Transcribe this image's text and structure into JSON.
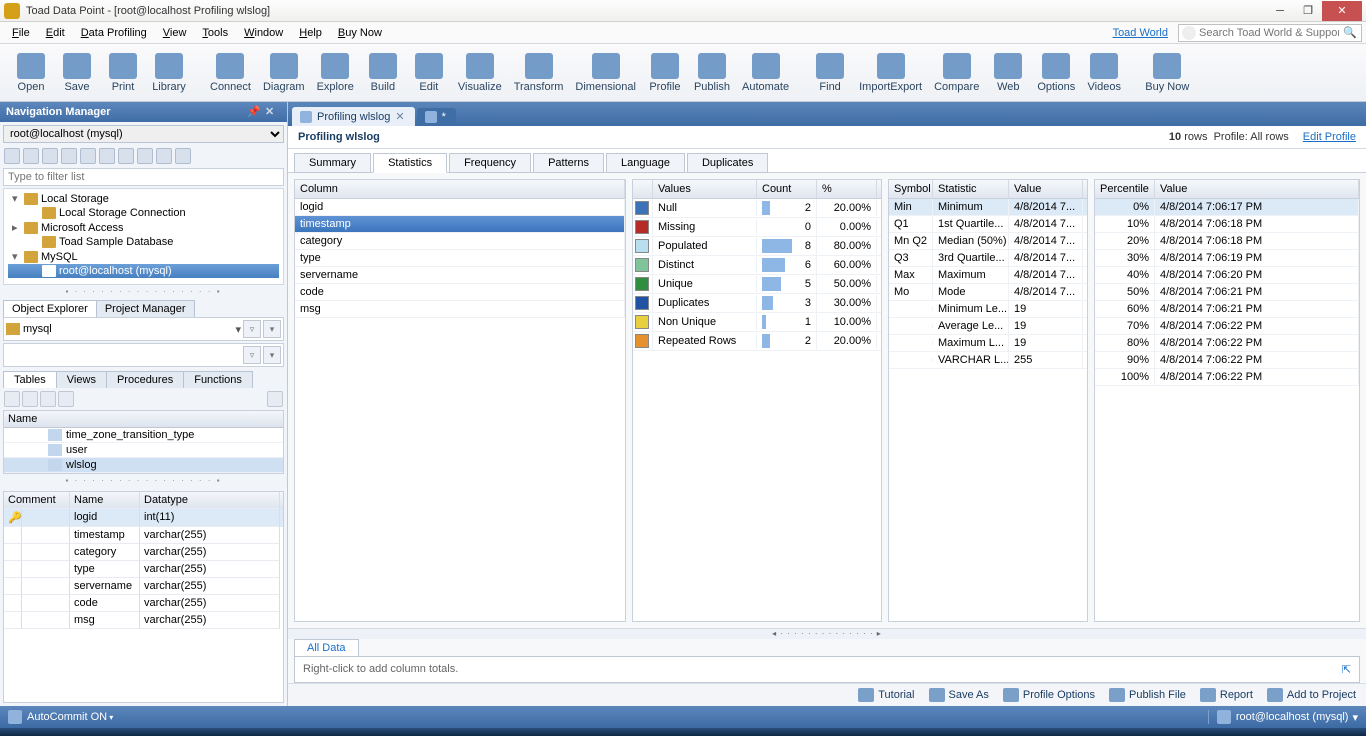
{
  "window": {
    "title": "Toad Data Point - [root@localhost Profiling wlslog]"
  },
  "menu": [
    "File",
    "Edit",
    "Data Profiling",
    "View",
    "Tools",
    "Window",
    "Help",
    "Buy Now"
  ],
  "menu_link": "Toad World",
  "search_placeholder": "Search Toad World & Support",
  "toolbar": [
    {
      "label": "Open"
    },
    {
      "label": "Save"
    },
    {
      "label": "Print"
    },
    {
      "label": "Library"
    },
    {
      "sep": true
    },
    {
      "label": "Connect"
    },
    {
      "label": "Diagram"
    },
    {
      "label": "Explore"
    },
    {
      "label": "Build"
    },
    {
      "label": "Edit"
    },
    {
      "label": "Visualize"
    },
    {
      "label": "Transform"
    },
    {
      "label": "Dimensional"
    },
    {
      "label": "Profile"
    },
    {
      "label": "Publish"
    },
    {
      "label": "Automate"
    },
    {
      "sep": true
    },
    {
      "label": "Find"
    },
    {
      "label": "ImportExport"
    },
    {
      "label": "Compare"
    },
    {
      "label": "Web"
    },
    {
      "label": "Options"
    },
    {
      "label": "Videos"
    },
    {
      "sep": true
    },
    {
      "label": "Buy Now"
    }
  ],
  "nav": {
    "title": "Navigation Manager",
    "connection": "root@localhost (mysql)",
    "filter_placeholder": "Type to filter list",
    "tree": [
      {
        "indent": 0,
        "expander": "▾",
        "label": "Local Storage"
      },
      {
        "indent": 1,
        "expander": "",
        "label": "Local Storage Connection"
      },
      {
        "indent": 0,
        "expander": "▸",
        "label": "Microsoft Access"
      },
      {
        "indent": 1,
        "expander": "",
        "label": "Toad Sample Database"
      },
      {
        "indent": 0,
        "expander": "▾",
        "label": "MySQL"
      },
      {
        "indent": 1,
        "expander": "",
        "label": "root@localhost (mysql)",
        "selected": true
      }
    ],
    "subtabs": [
      "Object Explorer",
      "Project Manager"
    ],
    "subtab_active": 0,
    "db_label": "mysql",
    "lower_tabs": [
      "Tables",
      "Views",
      "Procedures",
      "Functions"
    ],
    "lower_active": 0,
    "name_header": "Name",
    "name_rows": [
      {
        "label": "time_zone_transition_type"
      },
      {
        "label": "user"
      },
      {
        "label": "wlslog",
        "selected": true
      }
    ],
    "schema_headers": [
      "Comment",
      "Name",
      "Datatype"
    ],
    "schema_rows": [
      {
        "key": true,
        "selected": true,
        "name": "logid",
        "datatype": "int(11)"
      },
      {
        "name": "timestamp",
        "datatype": "varchar(255)"
      },
      {
        "name": "category",
        "datatype": "varchar(255)"
      },
      {
        "name": "type",
        "datatype": "varchar(255)"
      },
      {
        "name": "servername",
        "datatype": "varchar(255)"
      },
      {
        "name": "code",
        "datatype": "varchar(255)"
      },
      {
        "name": "msg",
        "datatype": "varchar(255)"
      }
    ]
  },
  "doc_tabs": [
    {
      "label": "Profiling wlslog",
      "active": true,
      "closable": true
    },
    {
      "label": "*",
      "icon_only": true
    }
  ],
  "profile": {
    "title": "Profiling wlslog",
    "rows_count": "10",
    "rows_label": "rows",
    "profile_label": "Profile: All rows",
    "edit_link": "Edit Profile"
  },
  "ptabs": [
    "Summary",
    "Statistics",
    "Frequency",
    "Patterns",
    "Language",
    "Duplicates"
  ],
  "ptab_active": 1,
  "columns_grid": {
    "header": "Column",
    "rows": [
      "logid",
      "timestamp",
      "category",
      "type",
      "servername",
      "code",
      "msg"
    ],
    "selected": 1
  },
  "values_grid": {
    "headers": [
      "",
      "Values",
      "Count",
      "%"
    ],
    "rows": [
      {
        "color": "#3c72b7",
        "label": "Null",
        "count": 2,
        "bar": 20,
        "pct": "20.00%"
      },
      {
        "color": "#b52b27",
        "label": "Missing",
        "count": 0,
        "bar": 0,
        "pct": "0.00%"
      },
      {
        "color": "#b8dff0",
        "label": "Populated",
        "count": 8,
        "bar": 80,
        "pct": "80.00%"
      },
      {
        "color": "#7fc49a",
        "label": "Distinct",
        "count": 6,
        "bar": 60,
        "pct": "60.00%"
      },
      {
        "color": "#2f8f3e",
        "label": "Unique",
        "count": 5,
        "bar": 50,
        "pct": "50.00%"
      },
      {
        "color": "#2153a4",
        "label": "Duplicates",
        "count": 3,
        "bar": 30,
        "pct": "30.00%"
      },
      {
        "color": "#e7cf3f",
        "label": "Non Unique",
        "count": 1,
        "bar": 10,
        "pct": "10.00%"
      },
      {
        "color": "#e6902e",
        "label": "Repeated Rows",
        "count": 2,
        "bar": 20,
        "pct": "20.00%"
      }
    ]
  },
  "stats_grid": {
    "headers": [
      "Symbol",
      "Statistic",
      "Value"
    ],
    "rows": [
      {
        "sym": "Min",
        "stat": "Minimum",
        "val": "4/8/2014 7...",
        "sel": true
      },
      {
        "sym": "Q1",
        "stat": "1st Quartile...",
        "val": "4/8/2014 7..."
      },
      {
        "sym": "Mn Q2",
        "stat": "Median (50%)",
        "val": "4/8/2014 7..."
      },
      {
        "sym": "Q3",
        "stat": "3rd Quartile...",
        "val": "4/8/2014 7..."
      },
      {
        "sym": "Max",
        "stat": "Maximum",
        "val": "4/8/2014 7..."
      },
      {
        "sym": "Mo",
        "stat": "Mode",
        "val": "4/8/2014 7..."
      },
      {
        "sym": "",
        "stat": "Minimum Le...",
        "val": "19"
      },
      {
        "sym": "",
        "stat": "Average Le...",
        "val": "19"
      },
      {
        "sym": "",
        "stat": "Maximum L...",
        "val": "19"
      },
      {
        "sym": "",
        "stat": "VARCHAR L...",
        "val": "255"
      }
    ]
  },
  "perc_grid": {
    "headers": [
      "Percentile",
      "Value"
    ],
    "rows": [
      {
        "p": "0%",
        "v": "4/8/2014 7:06:17 PM",
        "sel": true
      },
      {
        "p": "10%",
        "v": "4/8/2014 7:06:18 PM"
      },
      {
        "p": "20%",
        "v": "4/8/2014 7:06:18 PM"
      },
      {
        "p": "30%",
        "v": "4/8/2014 7:06:19 PM"
      },
      {
        "p": "40%",
        "v": "4/8/2014 7:06:20 PM"
      },
      {
        "p": "50%",
        "v": "4/8/2014 7:06:21 PM"
      },
      {
        "p": "60%",
        "v": "4/8/2014 7:06:21 PM"
      },
      {
        "p": "70%",
        "v": "4/8/2014 7:06:22 PM"
      },
      {
        "p": "80%",
        "v": "4/8/2014 7:06:22 PM"
      },
      {
        "p": "90%",
        "v": "4/8/2014 7:06:22 PM"
      },
      {
        "p": "100%",
        "v": "4/8/2014 7:06:22 PM"
      }
    ]
  },
  "all_data": {
    "tab": "All Data",
    "hint": "Right-click to add column totals."
  },
  "actions": [
    "Tutorial",
    "Save As",
    "Profile Options",
    "Publish File",
    "Report",
    "Add to Project"
  ],
  "status": {
    "left": "AutoCommit ON",
    "right": "root@localhost (mysql)"
  }
}
